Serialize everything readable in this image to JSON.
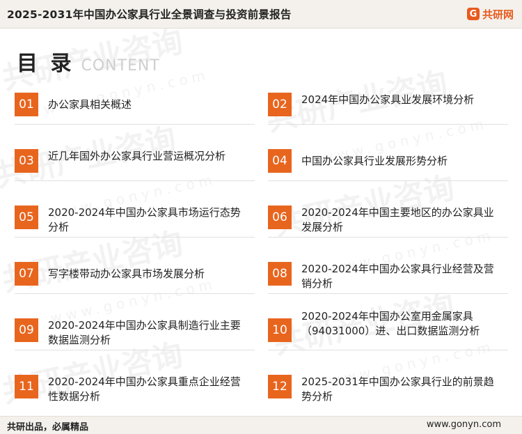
{
  "header": {
    "title": "2025-2031年中国办公家具行业全景调查与投资前景报告",
    "brand": "共研网",
    "brand_mark": "G"
  },
  "heading": {
    "cn": "目 录",
    "en": "CONTENT"
  },
  "watermarks": {
    "text": "共研产业咨询",
    "url": "www.gonyn.com"
  },
  "toc": [
    {
      "num": "01",
      "text": "办公家具相关概述"
    },
    {
      "num": "02",
      "text": "2024年中国办公家具业发展环境分析"
    },
    {
      "num": "03",
      "text": "近几年国外办公家具行业营运概况分析"
    },
    {
      "num": "04",
      "text": "中国办公家具行业发展形势分析"
    },
    {
      "num": "05",
      "text": "2020-2024年中国办公家具市场运行态势分析"
    },
    {
      "num": "06",
      "text": "2020-2024年中国主要地区的办公家具业发展分析"
    },
    {
      "num": "07",
      "text": "写字楼带动办公家具市场发展分析"
    },
    {
      "num": "08",
      "text": "2020-2024年中国办公家具行业经营及营销分析"
    },
    {
      "num": "09",
      "text": "2020-2024年中国办公家具制造行业主要数据监测分析"
    },
    {
      "num": "10",
      "text": "2020-2024年中国办公室用金属家具（94031000）进、出口数据监测分析"
    },
    {
      "num": "11",
      "text": "2020-2024年中国办公家具重点企业经营性数据分析"
    },
    {
      "num": "12",
      "text": "2025-2031年中国办公家具行业的前景趋势分析"
    }
  ],
  "footer": {
    "slogan": "共研出品，必属精品",
    "site": "www.gonyn.com"
  }
}
